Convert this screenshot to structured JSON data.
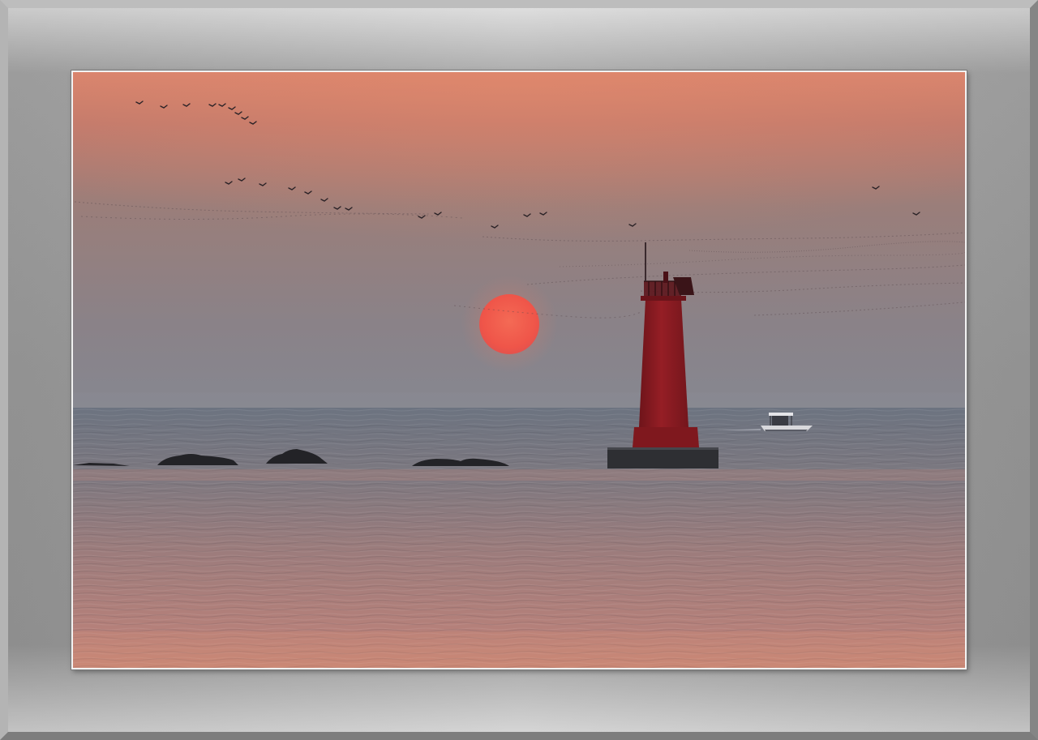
{
  "scene": {
    "subject": "sunset",
    "colors": {
      "frame": "#9e9e9e",
      "sky_top": "#d8846d",
      "sky_mid": "#9a7e7a",
      "sky_horizon": "#88878f",
      "sun": "#f0584a",
      "lighthouse": "#8e1c22",
      "sea_far": "#6f7683",
      "sea_near": "#c08378",
      "silhouette": "#222226"
    },
    "elements": [
      "birds-flock",
      "sun",
      "lighthouse",
      "rocks",
      "boat",
      "sea"
    ]
  }
}
